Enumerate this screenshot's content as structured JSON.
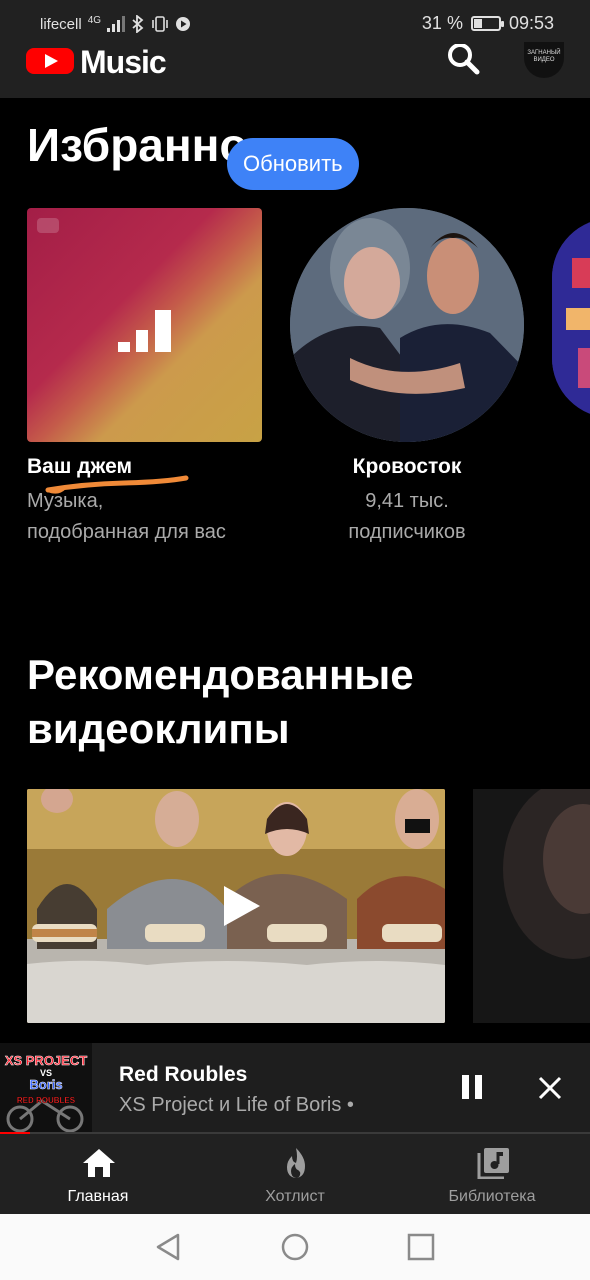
{
  "status_bar": {
    "carrier": "lifecell",
    "network": "4G",
    "battery_text": "31 %",
    "battery_level": 0.31,
    "time": "09:53"
  },
  "header": {
    "brand": "Music",
    "avatar_text": "ЗАГНАНЫЙ ВИДЕО"
  },
  "favorites": {
    "title": "Избранно",
    "refresh_label": "Обновить",
    "items": [
      {
        "title": "Ваш джем",
        "subtitle_line1": "Музыка,",
        "subtitle_line2": "подобранная для вас"
      },
      {
        "title": "Кровосток",
        "subtitle_line1": "9,41 тыс.",
        "subtitle_line2": "подписчиков"
      }
    ]
  },
  "recommended": {
    "title_line1": "Рекомендованные",
    "title_line2": "видеоклипы"
  },
  "mini_player": {
    "track": "Red Roubles",
    "artist": "XS Project и Life of Boris •",
    "art_text": [
      "XS PROJECT",
      "VS",
      "Boris",
      "RED ROUBLES"
    ],
    "progress": 0.05
  },
  "bottom_nav": {
    "items": [
      {
        "label": "Главная",
        "icon": "home-icon",
        "active": true
      },
      {
        "label": "Хотлист",
        "icon": "fire-icon",
        "active": false
      },
      {
        "label": "Библиотека",
        "icon": "library-icon",
        "active": false
      }
    ]
  },
  "colors": {
    "accent_red": "#ff0000",
    "refresh_blue": "#3e82f7",
    "background": "#000000",
    "bar_background": "#212121"
  }
}
